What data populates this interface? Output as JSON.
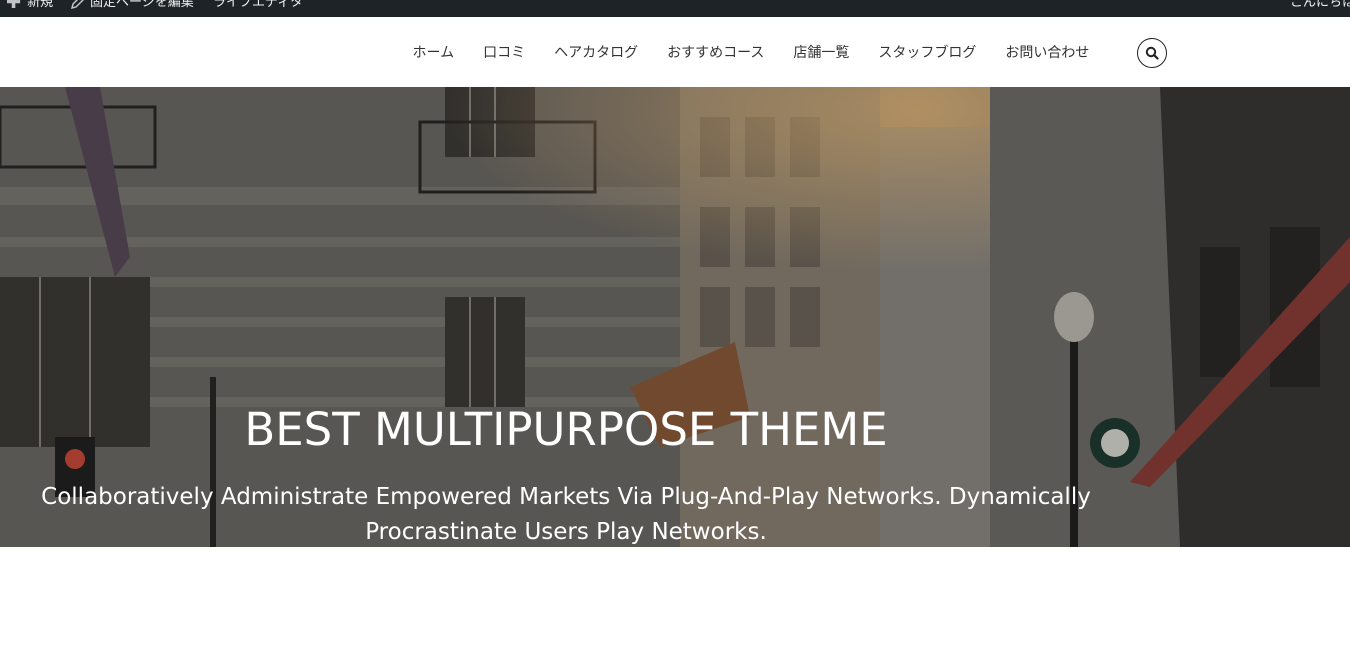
{
  "adminbar": {
    "new_label": "新規",
    "edit_label": "固定ページを編集",
    "editor_label": "ライブエディタ",
    "greeting": "こんにちは",
    "background": "#1d2327"
  },
  "nav": {
    "items": [
      {
        "label": "ホーム"
      },
      {
        "label": "口コミ"
      },
      {
        "label": "ヘアカタログ"
      },
      {
        "label": "おすすめコース"
      },
      {
        "label": "店舗一覧"
      },
      {
        "label": "スタッフブログ"
      },
      {
        "label": "お問い合わせ"
      }
    ],
    "search_icon": "search-icon"
  },
  "hero": {
    "title": "BEST MULTIPURPOSE THEME",
    "subtitle": "Collaboratively Administrate Empowered Markets Via Plug-And-Play Networks. Dynamically Procrastinate Users Play Networks."
  }
}
